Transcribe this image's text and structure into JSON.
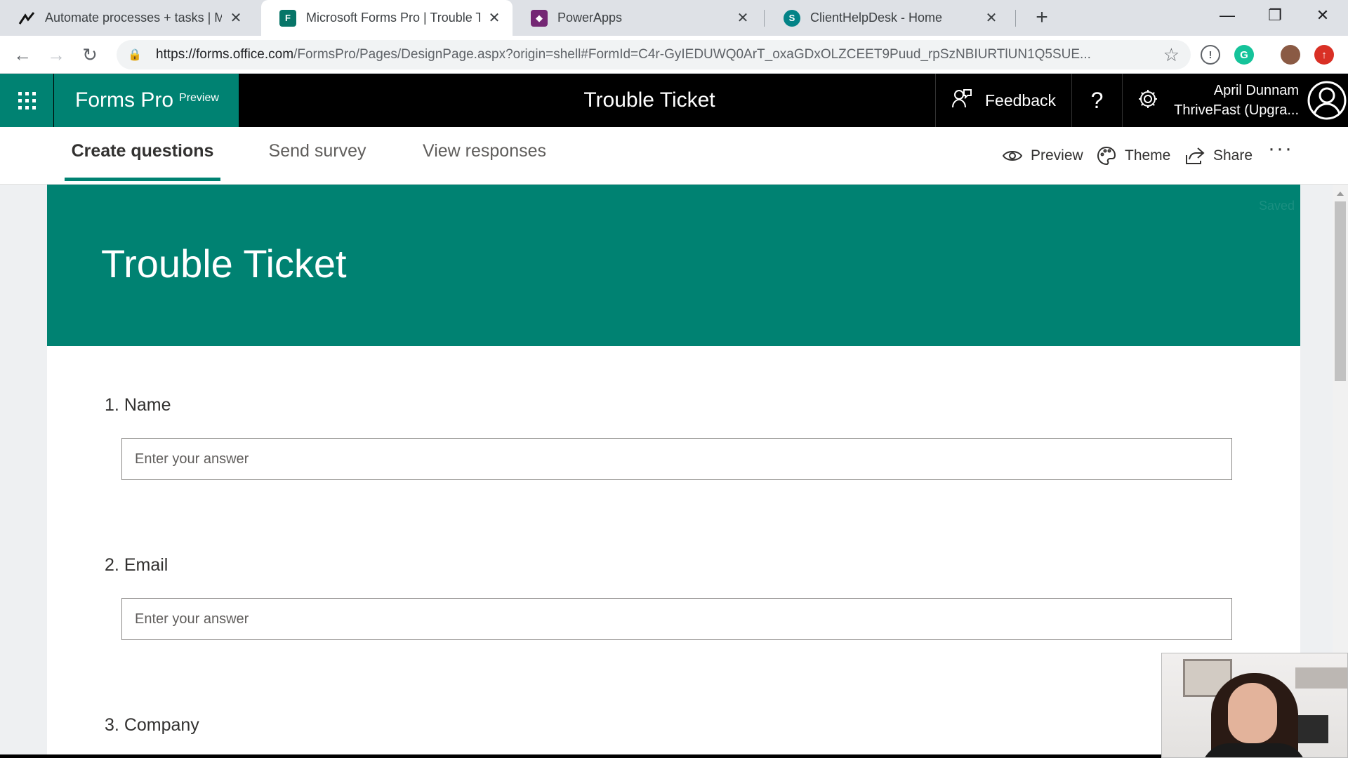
{
  "browser": {
    "tabs": [
      {
        "title": "Automate processes + tasks | Mi",
        "active": false
      },
      {
        "title": "Microsoft Forms Pro | Trouble Tic",
        "active": true
      },
      {
        "title": "PowerApps",
        "active": false
      },
      {
        "title": "ClientHelpDesk - Home",
        "active": false
      }
    ],
    "url_host": "https://forms.office.com",
    "url_path": "/FormsPro/Pages/DesignPage.aspx?origin=shell#FormId=C4r-GyIEDUWQ0ArT_oxaGDxOLZCEET9Puud_rpSzNBIURTlUN1Q5SUE..."
  },
  "app": {
    "brand": "Forms Pro",
    "brand_badge": "Preview",
    "title": "Trouble Ticket",
    "feedback_label": "Feedback",
    "help_label": "?",
    "user_name": "April Dunnam",
    "user_org": "ThriveFast (Upgra..."
  },
  "commandbar": {
    "tabs": [
      "Create questions",
      "Send survey",
      "View responses"
    ],
    "preview": "Preview",
    "theme": "Theme",
    "share": "Share",
    "more": "···"
  },
  "form": {
    "status": "Saved",
    "title": "Trouble Ticket",
    "questions": [
      {
        "number": "1.",
        "label": "Name",
        "placeholder": "Enter your answer"
      },
      {
        "number": "2.",
        "label": "Email",
        "placeholder": "Enter your answer"
      },
      {
        "number": "3.",
        "label": "Company"
      }
    ]
  },
  "colors": {
    "accent": "#008272",
    "header": "#000000"
  }
}
